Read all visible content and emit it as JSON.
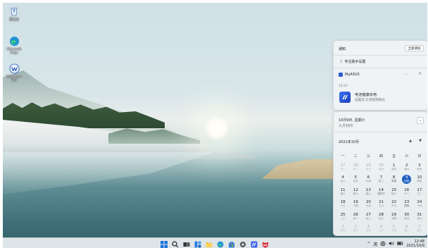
{
  "desktop": {
    "icons": [
      {
        "label": "回收站",
        "icon": "recycle-bin-icon"
      },
      {
        "label": "Microsoft Edge",
        "icon": "edge-icon"
      },
      {
        "label": "Wise Care 365",
        "icon": "wise-care-icon"
      }
    ]
  },
  "notifications": {
    "header": "通知",
    "clear_all": "全部清除",
    "focus_settings": "专注助手设置",
    "app_name": "MyASUS",
    "time": "12:47",
    "toast_title": "电池健康充电",
    "toast_body": "设置成 实测使用模式"
  },
  "calendar": {
    "date_line": "10月9日, 星期六",
    "lunar_line": "九月初四",
    "month_label": "2021年10月",
    "weekdays": [
      "一",
      "二",
      "三",
      "四",
      "五",
      "六",
      "日"
    ],
    "days": [
      {
        "n": "27",
        "l": "廿一",
        "dim": true
      },
      {
        "n": "28",
        "l": "廿二",
        "dim": true
      },
      {
        "n": "29",
        "l": "廿三",
        "dim": true
      },
      {
        "n": "30",
        "l": "廿四",
        "dim": true
      },
      {
        "n": "1",
        "l": "廿五"
      },
      {
        "n": "2",
        "l": "廿六"
      },
      {
        "n": "3",
        "l": "廿七"
      },
      {
        "n": "4",
        "l": "廿八"
      },
      {
        "n": "5",
        "l": "廿九"
      },
      {
        "n": "6",
        "l": "九月"
      },
      {
        "n": "7",
        "l": "初二"
      },
      {
        "n": "8",
        "l": "寒露"
      },
      {
        "n": "9",
        "l": "初四",
        "today": true
      },
      {
        "n": "10",
        "l": "初五"
      },
      {
        "n": "11",
        "l": "初六"
      },
      {
        "n": "12",
        "l": "初七"
      },
      {
        "n": "13",
        "l": "初八"
      },
      {
        "n": "14",
        "l": "重阳节"
      },
      {
        "n": "15",
        "l": "初十"
      },
      {
        "n": "16",
        "l": "十一"
      },
      {
        "n": "17",
        "l": "十二"
      },
      {
        "n": "18",
        "l": "十三"
      },
      {
        "n": "19",
        "l": "十四"
      },
      {
        "n": "20",
        "l": "十五"
      },
      {
        "n": "21",
        "l": "十六"
      },
      {
        "n": "22",
        "l": "十七"
      },
      {
        "n": "23",
        "l": "霜降"
      },
      {
        "n": "24",
        "l": "十九"
      },
      {
        "n": "25",
        "l": "二十"
      },
      {
        "n": "26",
        "l": "廿一"
      },
      {
        "n": "27",
        "l": "廿二"
      },
      {
        "n": "28",
        "l": "廿三"
      },
      {
        "n": "29",
        "l": "廿四"
      },
      {
        "n": "30",
        "l": "廿五"
      },
      {
        "n": "31",
        "l": "廿六"
      },
      {
        "n": "1",
        "l": "廿七",
        "dim": true
      },
      {
        "n": "2",
        "l": "廿八",
        "dim": true
      },
      {
        "n": "3",
        "l": "廿九",
        "dim": true
      },
      {
        "n": "4",
        "l": "三十",
        "dim": true
      },
      {
        "n": "5",
        "l": "十月",
        "dim": true
      },
      {
        "n": "6",
        "l": "初二",
        "dim": true
      },
      {
        "n": "7",
        "l": "初三",
        "dim": true
      }
    ]
  },
  "taskbar": {
    "icons": [
      "start-icon",
      "search-icon",
      "task-view-icon",
      "widgets-icon",
      "file-explorer-icon",
      "edge-icon",
      "store-icon",
      "settings-icon",
      "app-icon",
      "mcafee-icon"
    ],
    "tray": {
      "chevron": "^",
      "ime": "英",
      "clock_time": "12:48",
      "clock_date": "2021/10/9"
    }
  },
  "colors": {
    "accent": "#1d5fbf",
    "taskbar_bg": "#ecf0f3"
  }
}
